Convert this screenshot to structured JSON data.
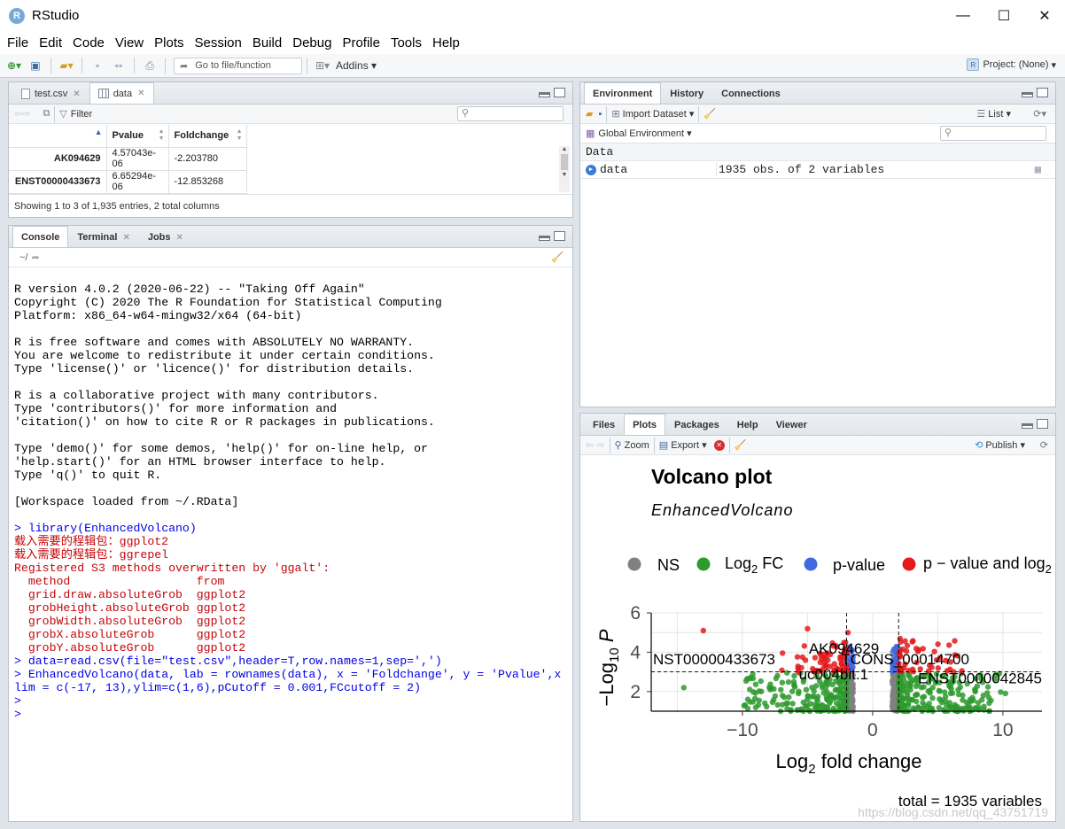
{
  "window": {
    "title": "RStudio",
    "minimize": "—",
    "maximize": "☐",
    "close": "✕"
  },
  "menu": [
    "File",
    "Edit",
    "Code",
    "View",
    "Plots",
    "Session",
    "Build",
    "Debug",
    "Profile",
    "Tools",
    "Help"
  ],
  "toolbar": {
    "goto_placeholder": "Go to file/function",
    "addins": "Addins",
    "project": "Project: (None)"
  },
  "source": {
    "tabs": [
      {
        "label": "test.csv"
      },
      {
        "label": "data"
      }
    ],
    "filter": "Filter",
    "columns": [
      "",
      "Pvalue",
      "Foldchange"
    ],
    "rows": [
      {
        "name": "AK094629",
        "pvalue": "4.57043e-06",
        "fold": "-2.203780"
      },
      {
        "name": "ENST00000433673",
        "pvalue": "6.65294e-06",
        "fold": "-12.853268"
      }
    ],
    "status": "Showing 1 to 3 of 1,935 entries, 2 total columns"
  },
  "console": {
    "tabs": [
      "Console",
      "Terminal",
      "Jobs"
    ],
    "path": "~/",
    "lines": [
      {
        "t": "out",
        "s": "R version 4.0.2 (2020-06-22) -- \"Taking Off Again\""
      },
      {
        "t": "out",
        "s": "Copyright (C) 2020 The R Foundation for Statistical Computing"
      },
      {
        "t": "out",
        "s": "Platform: x86_64-w64-mingw32/x64 (64-bit)"
      },
      {
        "t": "out",
        "s": ""
      },
      {
        "t": "out",
        "s": "R is free software and comes with ABSOLUTELY NO WARRANTY."
      },
      {
        "t": "out",
        "s": "You are welcome to redistribute it under certain conditions."
      },
      {
        "t": "out",
        "s": "Type 'license()' or 'licence()' for distribution details."
      },
      {
        "t": "out",
        "s": ""
      },
      {
        "t": "out",
        "s": "R is a collaborative project with many contributors."
      },
      {
        "t": "out",
        "s": "Type 'contributors()' for more information and"
      },
      {
        "t": "out",
        "s": "'citation()' on how to cite R or R packages in publications."
      },
      {
        "t": "out",
        "s": ""
      },
      {
        "t": "out",
        "s": "Type 'demo()' for some demos, 'help()' for on-line help, or"
      },
      {
        "t": "out",
        "s": "'help.start()' for an HTML browser interface to help."
      },
      {
        "t": "out",
        "s": "Type 'q()' to quit R."
      },
      {
        "t": "out",
        "s": ""
      },
      {
        "t": "out",
        "s": "[Workspace loaded from ~/.RData]"
      },
      {
        "t": "out",
        "s": ""
      },
      {
        "t": "in",
        "s": "> library(EnhancedVolcano)"
      },
      {
        "t": "err",
        "s": "载入需要的程辑包：ggplot2"
      },
      {
        "t": "err",
        "s": "载入需要的程辑包：ggrepel"
      },
      {
        "t": "err",
        "s": "Registered S3 methods overwritten by 'ggalt':"
      },
      {
        "t": "err",
        "s": "  method                  from   "
      },
      {
        "t": "err",
        "s": "  grid.draw.absoluteGrob  ggplot2"
      },
      {
        "t": "err",
        "s": "  grobHeight.absoluteGrob ggplot2"
      },
      {
        "t": "err",
        "s": "  grobWidth.absoluteGrob  ggplot2"
      },
      {
        "t": "err",
        "s": "  grobX.absoluteGrob      ggplot2"
      },
      {
        "t": "err",
        "s": "  grobY.absoluteGrob      ggplot2"
      },
      {
        "t": "in",
        "s": "> data=read.csv(file=\"test.csv\",header=T,row.names=1,sep=',')"
      },
      {
        "t": "in",
        "s": "> EnhancedVolcano(data, lab = rownames(data), x = 'Foldchange', y = 'Pvalue',x"
      },
      {
        "t": "in",
        "s": "lim = c(-17, 13),ylim=c(1,6),pCutoff = 0.001,FCcutoff = 2)"
      },
      {
        "t": "in",
        "s": "> "
      },
      {
        "t": "in",
        "s": "> "
      }
    ]
  },
  "environment": {
    "tabs": [
      "Environment",
      "History",
      "Connections"
    ],
    "import": "Import Dataset",
    "list": "List",
    "scope": "Global Environment",
    "section": "Data",
    "items": [
      {
        "name": "data",
        "value": "1935 obs. of 2 variables"
      }
    ]
  },
  "files": {
    "tabs": [
      "Files",
      "Plots",
      "Packages",
      "Help",
      "Viewer"
    ],
    "zoom": "Zoom",
    "export": "Export",
    "publish": "Publish"
  },
  "chart_data": {
    "type": "scatter",
    "title": "Volcano plot",
    "subtitle": "EnhancedVolcano",
    "xlabel": "Log2 fold change",
    "ylabel": "−Log10 P",
    "xlim": [
      -17,
      13
    ],
    "ylim": [
      1,
      6
    ],
    "xticks": [
      "−10",
      "0",
      "10"
    ],
    "yticks": [
      "2",
      "4",
      "6"
    ],
    "legend": [
      "NS",
      "Log2 FC",
      "p-value",
      "p − value and log2"
    ],
    "colors": {
      "ns": "#808080",
      "fc": "#2e9a2e",
      "p": "#4169e1",
      "both": "#e41a1c"
    },
    "cutoff_lines": {
      "fc": 2,
      "p_y": 3
    },
    "labels": [
      {
        "text": "NST00000433673",
        "x": -13.5,
        "y": 3.65
      },
      {
        "text": "AK094629",
        "x": -2.2,
        "y": 4.2
      },
      {
        "text": "TCONS_00014700",
        "x": 2.5,
        "y": 3.65
      },
      {
        "text": "uc004bit.1",
        "x": -3,
        "y": 2.9
      },
      {
        "text": "ENST0000042845",
        "x": 8,
        "y": 2.7
      }
    ],
    "caption": "total = 1935 variables"
  },
  "watermark": "https://blog.csdn.net/qq_43751719"
}
